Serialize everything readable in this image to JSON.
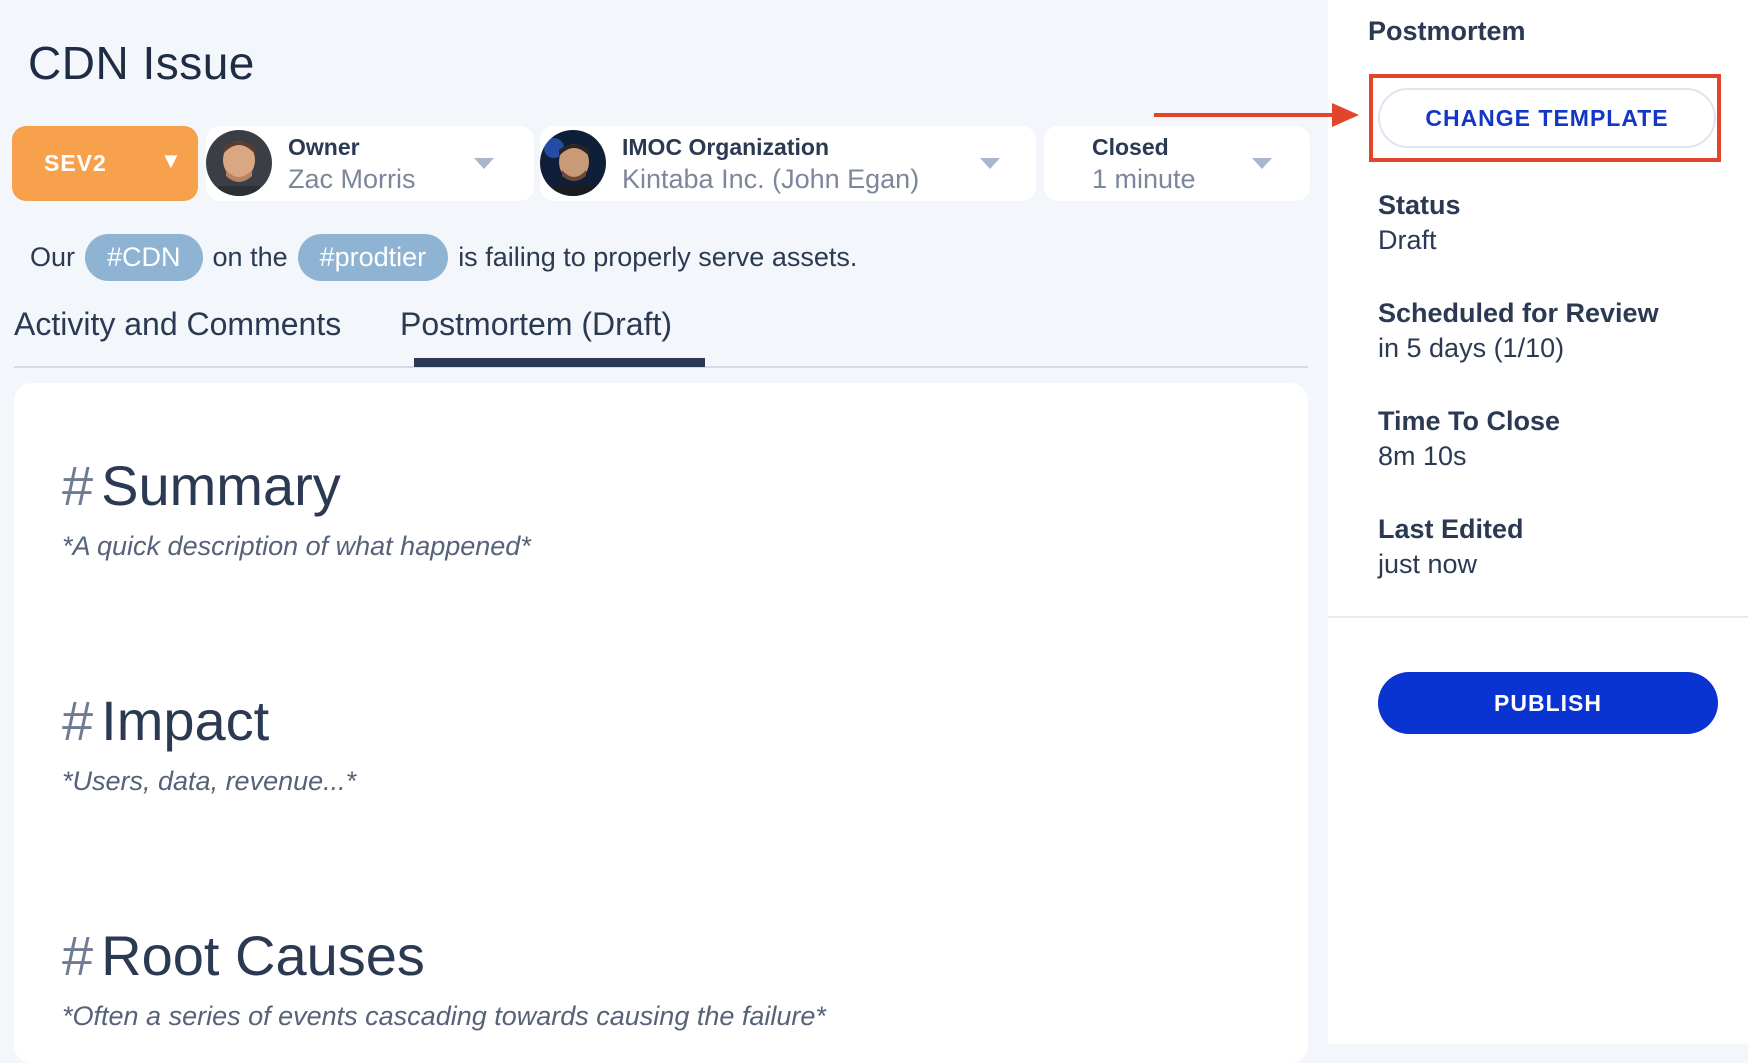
{
  "page": {
    "title": "CDN Issue"
  },
  "severity": {
    "label": "SEV2",
    "caret": "▼",
    "color": "#f8a14d"
  },
  "owner": {
    "label": "Owner",
    "value": "Zac Morris"
  },
  "organization": {
    "label": "IMOC Organization",
    "value": "Kintaba Inc. (John Egan)"
  },
  "closed": {
    "label": "Closed",
    "value": "1 minute"
  },
  "description": {
    "prefix": "Our",
    "tag1": "#CDN",
    "middle": "on the",
    "tag2": "#prodtier",
    "suffix": "is failing to properly serve assets."
  },
  "tabs": [
    {
      "label": "Activity and Comments",
      "active": false
    },
    {
      "label": "Postmortem (Draft)",
      "active": true
    }
  ],
  "sections": [
    {
      "hash": "#",
      "heading": "Summary",
      "hint": "*A quick description of what happened*"
    },
    {
      "hash": "#",
      "heading": "Impact",
      "hint": "*Users, data, revenue...*"
    },
    {
      "hash": "#",
      "heading": "Root Causes",
      "hint": "*Often a series of events cascading towards causing the failure*"
    }
  ],
  "sidebar": {
    "title": "Postmortem",
    "change_template": "CHANGE TEMPLATE",
    "fields": [
      {
        "label": "Status",
        "value": "Draft"
      },
      {
        "label": "Scheduled for Review",
        "value": "in 5 days (1/10)"
      },
      {
        "label": "Time To Close",
        "value": "8m 10s"
      },
      {
        "label": "Last Edited",
        "value": "just now"
      }
    ],
    "publish": "PUBLISH"
  },
  "colors": {
    "accent": "#0a34d2",
    "highlight": "#e3452c",
    "tag": "#8eb3d3"
  }
}
